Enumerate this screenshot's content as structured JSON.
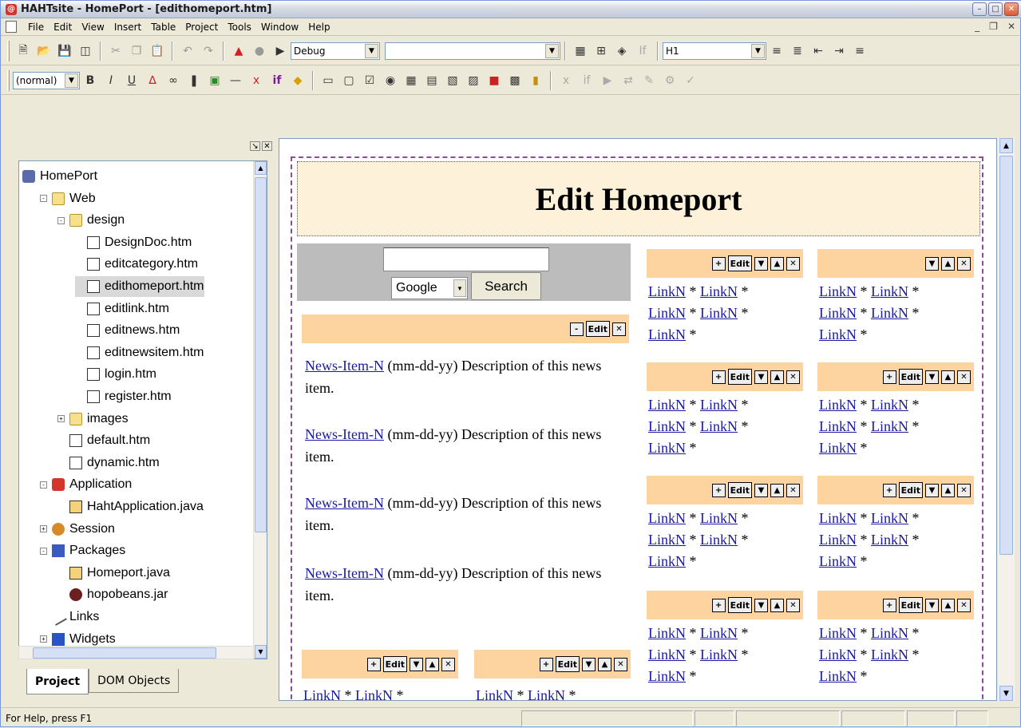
{
  "window": {
    "title": "HAHTsite - HomePort - [edithomeport.htm]"
  },
  "menu": [
    "File",
    "Edit",
    "View",
    "Insert",
    "Table",
    "Project",
    "Tools",
    "Window",
    "Help"
  ],
  "toolbar": {
    "config_select": "Debug",
    "style_select": "H1",
    "para_select": "(normal)",
    "empty_select": ""
  },
  "tree": {
    "items": [
      {
        "label": "HomePort",
        "icon": "homeport-icon",
        "indent": 0,
        "exp": ""
      },
      {
        "label": "Web",
        "icon": "folder-icon",
        "indent": 1,
        "exp": "-"
      },
      {
        "label": "design",
        "icon": "folder-icon",
        "indent": 2,
        "exp": "-"
      },
      {
        "label": "DesignDoc.htm",
        "icon": "html-file-icon",
        "indent": 3,
        "exp": ""
      },
      {
        "label": "editcategory.htm",
        "icon": "html-file-icon",
        "indent": 3,
        "exp": ""
      },
      {
        "label": "edithomeport.htm",
        "icon": "html-file-icon",
        "indent": 3,
        "exp": "",
        "selected": true
      },
      {
        "label": "editlink.htm",
        "icon": "html-file-icon",
        "indent": 3,
        "exp": ""
      },
      {
        "label": "editnews.htm",
        "icon": "html-file-icon",
        "indent": 3,
        "exp": ""
      },
      {
        "label": "editnewsitem.htm",
        "icon": "html-file-icon",
        "indent": 3,
        "exp": ""
      },
      {
        "label": "login.htm",
        "icon": "html-file-icon",
        "indent": 3,
        "exp": ""
      },
      {
        "label": "register.htm",
        "icon": "html-file-icon",
        "indent": 3,
        "exp": ""
      },
      {
        "label": "images",
        "icon": "folder-icon",
        "indent": 2,
        "exp": "+"
      },
      {
        "label": "default.htm",
        "icon": "html-file-icon",
        "indent": 2,
        "exp": ""
      },
      {
        "label": "dynamic.htm",
        "icon": "html-file-icon",
        "indent": 2,
        "exp": ""
      },
      {
        "label": "Application",
        "icon": "application-icon",
        "indent": 1,
        "exp": "-"
      },
      {
        "label": "HahtApplication.java",
        "icon": "java-file-icon",
        "indent": 2,
        "exp": ""
      },
      {
        "label": "Session",
        "icon": "session-icon",
        "indent": 1,
        "exp": "+"
      },
      {
        "label": "Packages",
        "icon": "packages-icon",
        "indent": 1,
        "exp": "-"
      },
      {
        "label": "Homeport.java",
        "icon": "java-file-icon",
        "indent": 2,
        "exp": ""
      },
      {
        "label": "hopobeans.jar",
        "icon": "jar-icon",
        "indent": 2,
        "exp": ""
      },
      {
        "label": "Links",
        "icon": "links-icon",
        "indent": 1,
        "exp": ""
      },
      {
        "label": "Widgets",
        "icon": "widgets-icon",
        "indent": 1,
        "exp": "+"
      }
    ]
  },
  "tabs": {
    "project": "Project",
    "dom": "DOM Objects"
  },
  "page": {
    "heading": "Edit Homeport",
    "search_button": "Search",
    "engine": "Google",
    "edit": "Edit",
    "news_link": "News-Item-N",
    "news_desc": " (mm-dd-yy) Description of this news item.",
    "link": "LinkN",
    "sep": " * "
  },
  "status": {
    "text": "For Help, press F1"
  }
}
